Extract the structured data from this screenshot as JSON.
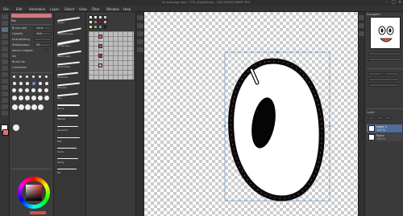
{
  "window": {
    "title": "7ai wall.png(.clip) - 77% (Gray/Scale) - CLIP STUDIO PAINT PRO"
  },
  "menu": {
    "items": [
      "File",
      "Edit",
      "Animation",
      "Layer",
      "Select",
      "View",
      "Filter",
      "Window",
      "Help"
    ]
  },
  "subtool": {
    "header": "Pen",
    "rows": [
      {
        "label": "Brush size",
        "value": "12.0"
      },
      {
        "label": "Opacity",
        "value": "100"
      },
      {
        "label": "Anti-aliasing",
        "value": ""
      },
      {
        "label": "Stabilization",
        "value": "35"
      },
      {
        "label": "Vector magnet",
        "value": ""
      },
      {
        "label": "Ink",
        "value": ""
      },
      {
        "label": "Brush tip",
        "value": ""
      },
      {
        "label": "Correction",
        "value": ""
      }
    ]
  },
  "brushes": {
    "names": [
      "G-pen",
      "Mapping pen",
      "Turnip pen",
      "Real G-pen",
      "Round pen",
      "Textured",
      "Dot pen",
      "Pen",
      "Brush",
      "Marker",
      "Gouache",
      "Felt",
      "Sumi",
      "Spray",
      "Fill"
    ]
  },
  "palette": {
    "colors": [
      "#ffffff",
      "#f0f0f0",
      "#e0e0e0",
      "#d0d0d0",
      "#ffffff",
      "#e05a5a",
      "#c00000",
      "#f2a0a0",
      "#ffe070",
      "#70c070",
      "#60a0e0",
      "#202020"
    ]
  },
  "color": {
    "main": "#ffffff",
    "sub": "#e07070",
    "accent": "#d05050"
  },
  "navigator": {
    "title": "Navigator"
  },
  "layers": {
    "title": "Layer",
    "items": [
      {
        "name": "Layer 1",
        "opacity": "100 %"
      },
      {
        "name": "Paper",
        "opacity": "100 %"
      }
    ]
  },
  "icons": {
    "pen": "pen-icon",
    "eraser": "eraser-icon",
    "fill": "fill-icon",
    "select": "select-icon",
    "move": "move-icon",
    "eyedropper": "eyedropper-icon",
    "text": "text-icon",
    "hand": "hand-icon"
  }
}
